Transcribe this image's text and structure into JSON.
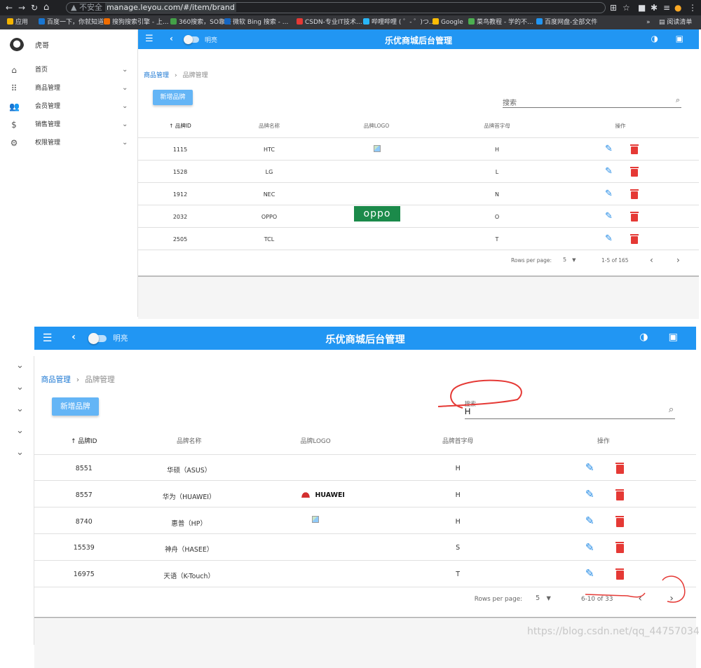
{
  "browser": {
    "url_insecure": "▲ 不安全",
    "url": "manage.leyou.com/#/item/brand",
    "bookmarks": [
      {
        "label": "应用",
        "color": "#f4b400"
      },
      {
        "label": "百度一下，你就知道",
        "color": "#1976d2"
      },
      {
        "label": "搜狗搜索引擎 - 上...",
        "color": "#ef6c00"
      },
      {
        "label": "360搜索，SO靠谱",
        "color": "#43a047"
      },
      {
        "label": "微软 Bing 搜索 - ...",
        "color": "#1565c0"
      },
      {
        "label": "CSDN-专业IT技术...",
        "color": "#e53935"
      },
      {
        "label": "哔哩哔哩 ( ゜- ゜)つ...",
        "color": "#29b6f6"
      },
      {
        "label": "Google",
        "color": "#fbbc05"
      },
      {
        "label": "菜鸟教程 - 学的不...",
        "color": "#4caf50"
      },
      {
        "label": "百度网盘-全部文件",
        "color": "#2196f3"
      }
    ],
    "reading_list": "阅读清单"
  },
  "sidebar": {
    "user": "虎哥",
    "items": [
      {
        "label": "首页",
        "icon": "home-icon"
      },
      {
        "label": "商品管理",
        "icon": "apps-icon"
      },
      {
        "label": "会员管理",
        "icon": "people-icon"
      },
      {
        "label": "销售管理",
        "icon": "dollar-icon"
      },
      {
        "label": "权限管理",
        "icon": "gear-icon"
      }
    ]
  },
  "appbar": {
    "title": "乐优商城后台管理",
    "theme_label": "明亮"
  },
  "breadcrumb": {
    "parent": "商品管理",
    "current": "品牌管理"
  },
  "add_button": "新增品牌",
  "search_placeholder": "搜索",
  "table_headers": [
    "↑ 品牌ID",
    "品牌名称",
    "品牌LOGO",
    "品牌首字母",
    "操作"
  ],
  "rows_per_page_label": "Rows per page:",
  "panel_top": {
    "search_value": "",
    "rows": [
      {
        "id": "1115",
        "name": "HTC",
        "logo": "broken",
        "letter": "H"
      },
      {
        "id": "1528",
        "name": "LG",
        "logo": "",
        "letter": "L"
      },
      {
        "id": "1912",
        "name": "NEC",
        "logo": "",
        "letter": "N"
      },
      {
        "id": "2032",
        "name": "OPPO",
        "logo": "oppo",
        "letter": "O"
      },
      {
        "id": "2505",
        "name": "TCL",
        "logo": "",
        "letter": "T"
      }
    ],
    "rows_per_page": "5",
    "range": "1-5 of 165"
  },
  "panel_bottom": {
    "search_value": "H",
    "rows": [
      {
        "id": "8551",
        "name": "华硕（ASUS）",
        "logo": "",
        "letter": "H"
      },
      {
        "id": "8557",
        "name": "华为（HUAWEI）",
        "logo": "huawei",
        "letter": "H"
      },
      {
        "id": "8740",
        "name": "惠普（HP）",
        "logo": "broken",
        "letter": "H"
      },
      {
        "id": "15539",
        "name": "神舟（HASEE）",
        "logo": "",
        "letter": "S"
      },
      {
        "id": "16975",
        "name": "天语（K-Touch）",
        "logo": "",
        "letter": "T"
      }
    ],
    "rows_per_page": "5",
    "range": "6-10 of 33"
  },
  "logo_text": {
    "oppo": "oppo",
    "huawei": "HUAWEI"
  },
  "watermark": "https://blog.csdn.net/qq_44757034",
  "colors": {
    "primary": "#2196f3",
    "add_button": "#64b5f6",
    "delete": "#e53935",
    "annotation": "#e53935"
  }
}
